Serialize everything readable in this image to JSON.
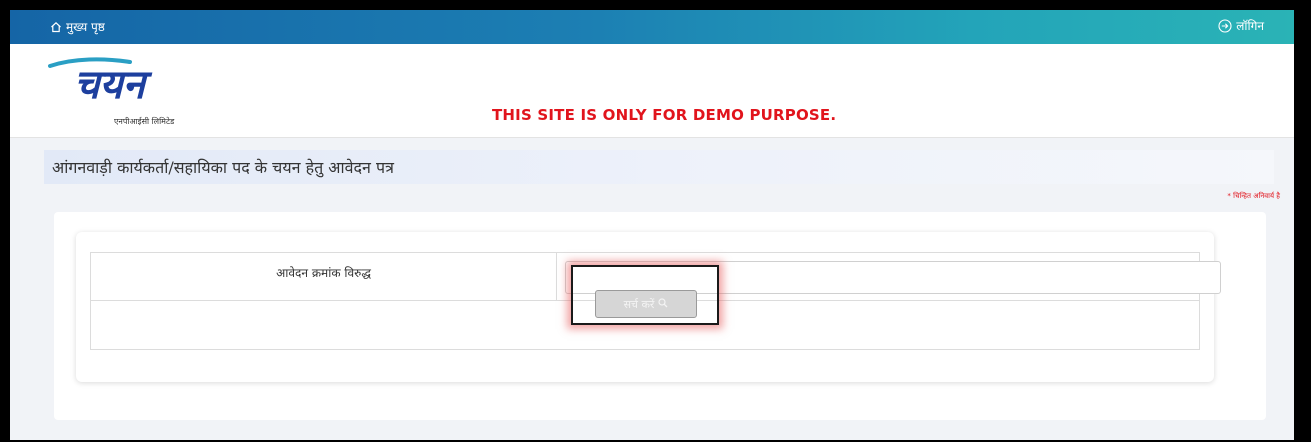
{
  "topbar": {
    "home_label": "मुख्य पृष्ठ",
    "login_label": "लॉगिन",
    "icons": {
      "home": "home-icon",
      "login": "login-icon"
    },
    "gradient_colors": [
      "#1565a6",
      "#2ab3b6"
    ]
  },
  "header": {
    "logo_text": "चयन",
    "logo_subtitle": "एनपीआईसी लिमिटेड",
    "demo_note": "THIS SITE IS ONLY FOR DEMO PURPOSE.",
    "demo_note_color": "#e1141c"
  },
  "main": {
    "page_title": "आंगनवाड़ी कार्यकर्ता/सहायिका पद के चयन हेतु आवेदन पत्र",
    "required_note": "* चिन्हित अनिवार्य है",
    "form": {
      "field_label": "आवेदन क्रमांक विरुद्ध",
      "field_value": "",
      "search_button_label": "सर्च करें",
      "search_button_icon": "search-icon"
    }
  }
}
